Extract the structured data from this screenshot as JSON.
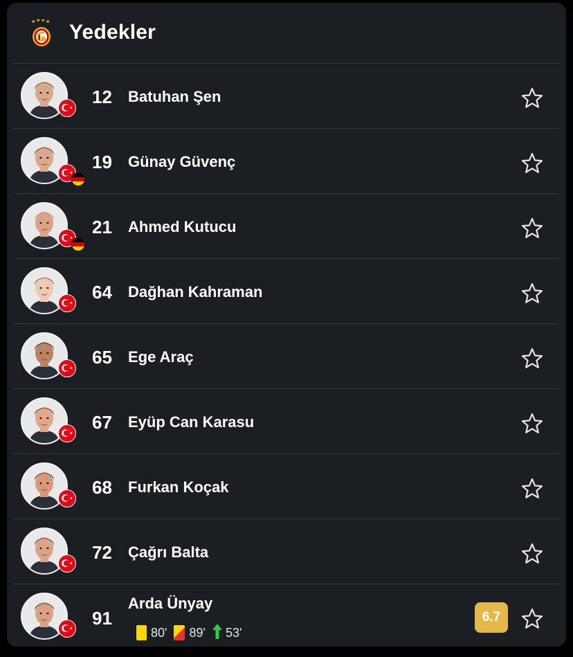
{
  "section": {
    "title": "Yedekler",
    "club_logo_icon": "galatasaray-crest-icon"
  },
  "colors": {
    "card_bg": "#1b1e22",
    "divider": "#363a40",
    "rating_bg": "#e4b94a",
    "yellow_card": "#f5d800",
    "red_card": "#e8352c",
    "sub_arrow": "#2ecc40",
    "turkey_flag": "#e30a17"
  },
  "players": [
    {
      "number": "12",
      "name": "Batuhan Şen",
      "flags": [
        "turkey-flag-icon"
      ],
      "skin": "#d8a98a",
      "hair": "#4a2e1e"
    },
    {
      "number": "19",
      "name": "Günay Güvenç",
      "flags": [
        "turkey-flag-icon",
        "germany-flag-icon"
      ],
      "skin": "#d8a98a",
      "hair": "#2a201a"
    },
    {
      "number": "21",
      "name": "Ahmed Kutucu",
      "flags": [
        "turkey-flag-icon",
        "germany-flag-icon"
      ],
      "skin": "#d9a486",
      "hair": "#b09070"
    },
    {
      "number": "64",
      "name": "Dağhan Kahraman",
      "flags": [
        "turkey-flag-icon"
      ],
      "skin": "#f0c9b4",
      "hair": "#5a3a28"
    },
    {
      "number": "65",
      "name": "Ege Araç",
      "flags": [
        "turkey-flag-icon"
      ],
      "skin": "#b98464",
      "hair": "#1a1412"
    },
    {
      "number": "67",
      "name": "Eyüp Can Karasu",
      "flags": [
        "turkey-flag-icon"
      ],
      "skin": "#e2a88a",
      "hair": "#1e1612"
    },
    {
      "number": "68",
      "name": "Furkan Koçak",
      "flags": [
        "turkey-flag-icon"
      ],
      "skin": "#d79a78",
      "hair": "#241a14"
    },
    {
      "number": "72",
      "name": "Çağrı Balta",
      "flags": [
        "turkey-flag-icon"
      ],
      "skin": "#dba487",
      "hair": "#2a1e16"
    },
    {
      "number": "91",
      "name": "Arda Ünyay",
      "flags": [
        "turkey-flag-icon"
      ],
      "skin": "#d9a084",
      "hair": "#1e1612",
      "rating": "6.7",
      "events": [
        {
          "type": "yellow-card",
          "icon": "yellow-card-icon",
          "minute": "80'"
        },
        {
          "type": "second-yellow-red-card",
          "icon": "yellow-red-card-icon",
          "minute": "89'"
        },
        {
          "type": "substitution-in",
          "icon": "sub-in-arrow-icon",
          "minute": "53'"
        }
      ]
    }
  ]
}
